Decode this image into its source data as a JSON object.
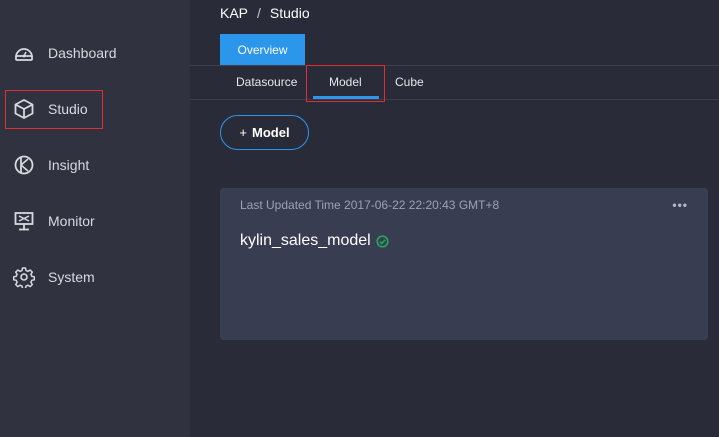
{
  "sidebar": {
    "items": [
      {
        "label": "Dashboard",
        "icon": "dashboard-icon"
      },
      {
        "label": "Studio",
        "icon": "cube-icon"
      },
      {
        "label": "Insight",
        "icon": "insight-icon"
      },
      {
        "label": "Monitor",
        "icon": "monitor-icon"
      },
      {
        "label": "System",
        "icon": "gear-icon"
      }
    ]
  },
  "breadcrumb": {
    "root": "KAP",
    "separator": "/",
    "current": "Studio"
  },
  "tabs": {
    "overview": "Overview"
  },
  "subtabs": {
    "datasource": "Datasource",
    "model": "Model",
    "cube": "Cube"
  },
  "actions": {
    "add_model_plus": "+",
    "add_model_label": "Model"
  },
  "model_card": {
    "updated_label": "Last Updated Time 2017-06-22 22:20:43 GMT+8",
    "more": "•••",
    "name": "kylin_sales_model",
    "status_icon": "check-circle-icon"
  },
  "colors": {
    "accent": "#2b96ea",
    "highlight": "#e12f2f",
    "success": "#21a956"
  }
}
